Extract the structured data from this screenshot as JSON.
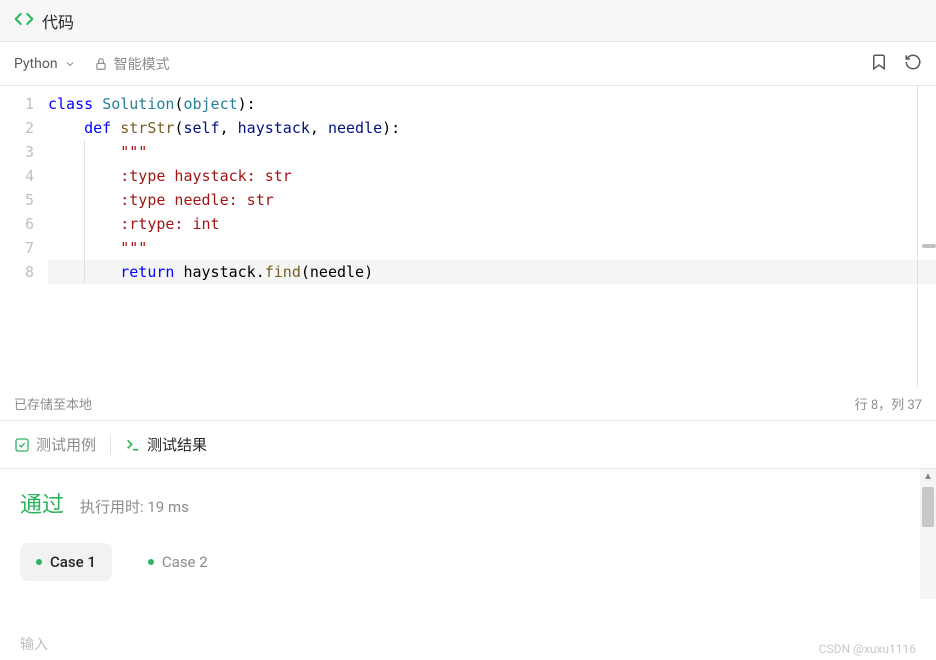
{
  "header": {
    "title": "代码"
  },
  "toolbar": {
    "language": "Python",
    "mode_label": "智能模式"
  },
  "code": {
    "lines": [
      {
        "num": "1"
      },
      {
        "num": "2"
      },
      {
        "num": "3"
      },
      {
        "num": "4"
      },
      {
        "num": "5"
      },
      {
        "num": "6"
      },
      {
        "num": "7"
      },
      {
        "num": "8"
      }
    ],
    "tokens": {
      "l1_kw1": "class",
      "l1_cls": "Solution",
      "l1_p1": "(",
      "l1_obj": "object",
      "l1_p2": "):",
      "l2_kw1": "def",
      "l2_fn": "strStr",
      "l2_p1": "(",
      "l2_self": "self",
      "l2_c1": ", ",
      "l2_a1": "haystack",
      "l2_c2": ", ",
      "l2_a2": "needle",
      "l2_p2": "):",
      "l3": "\"\"\"",
      "l4": ":type haystack: str",
      "l5": ":type needle: str",
      "l6": ":rtype: int",
      "l7": "\"\"\"",
      "l8_kw": "return",
      "l8_txt1": " haystack",
      "l8_dot": ".",
      "l8_fn": "find",
      "l8_p1": "(",
      "l8_arg": "needle",
      "l8_p2": ")"
    }
  },
  "status": {
    "saved": "已存储至本地",
    "cursor": "行 8，列 37"
  },
  "tabs": {
    "test_cases": "测试用例",
    "test_results": "测试结果"
  },
  "result": {
    "pass": "通过",
    "runtime": "执行用时: 19 ms",
    "cases": [
      {
        "label": "Case 1"
      },
      {
        "label": "Case 2"
      }
    ]
  },
  "footer": {
    "input_label": "输入",
    "watermark": "CSDN @xuxu1116"
  }
}
